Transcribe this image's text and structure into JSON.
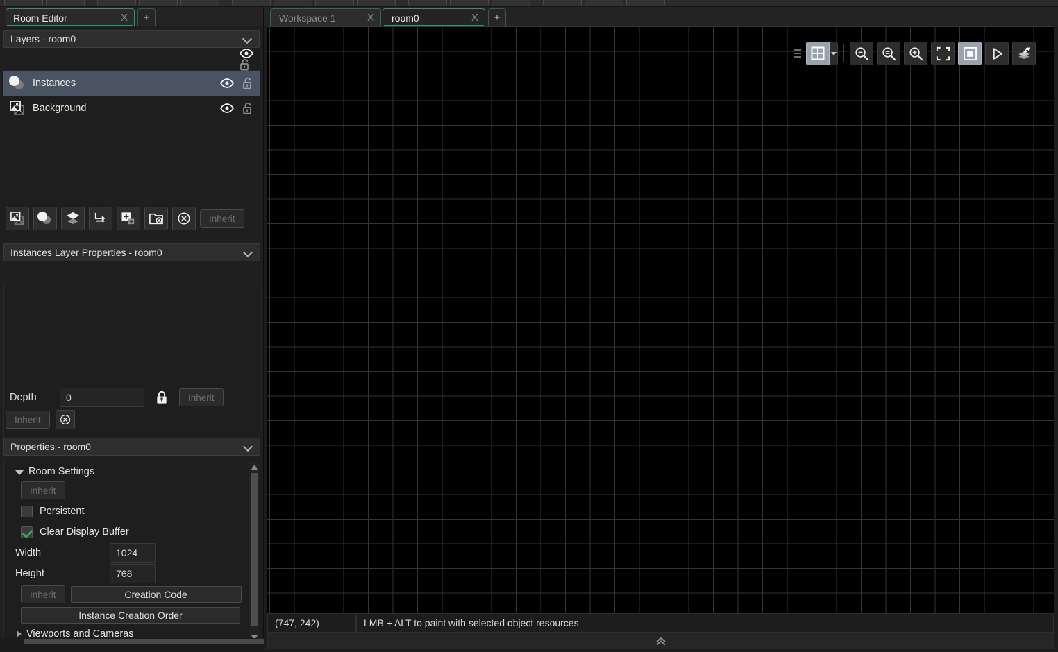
{
  "app": {
    "accent_green": "#16a864",
    "selection_blue": "#4a5361"
  },
  "left_dock": {
    "tab": {
      "title": "Room Editor",
      "close": "X",
      "add": "+"
    },
    "layers_panel": {
      "title": "Layers - room0",
      "chevron_icon": "chevron-down-icon",
      "layers": [
        {
          "name": "Instances",
          "type_icon": "instances-layer-icon",
          "visible_icon": "eye-icon",
          "lock_icon": "unlocked-padlock-icon",
          "selected": true
        },
        {
          "name": "Background",
          "type_icon": "background-layer-icon",
          "visible_icon": "eye-icon",
          "lock_icon": "unlocked-padlock-icon",
          "selected": false
        }
      ],
      "header_icons": {
        "visible_icon": "eye-icon",
        "lock_icon": "unlocked-padlock-icon"
      }
    },
    "layer_tools": [
      {
        "name": "add-background-layer-button",
        "icon": "image-layer-icon"
      },
      {
        "name": "add-instance-layer-button",
        "icon": "instances-layer-icon"
      },
      {
        "name": "add-asset-layer-button",
        "icon": "stacked-diamonds-icon"
      },
      {
        "name": "add-path-layer-button",
        "icon": "path-corner-arrow-icon"
      },
      {
        "name": "add-tile-layer-button",
        "icon": "plus-square-icon"
      },
      {
        "name": "add-layer-folder-button",
        "icon": "folder-plus-icon"
      },
      {
        "name": "delete-layer-button",
        "icon": "circle-x-icon"
      }
    ],
    "layer_tools_inherit": "Inherit",
    "layer_properties_panel": {
      "title": "Instances Layer Properties - room0",
      "chevron_icon": "chevron-down-icon",
      "depth_label": "Depth",
      "depth_value": "0",
      "depth_lock_icon": "locked-padlock-icon",
      "depth_inherit": "Inherit",
      "bottom_inherit": "Inherit",
      "bottom_clear_icon": "circle-x-icon"
    },
    "properties_panel": {
      "title": "Properties - room0",
      "chevron_icon": "chevron-down-icon",
      "room_settings": {
        "group_label": "Room Settings",
        "expanded": true,
        "inherit_label": "Inherit",
        "persistent": {
          "label": "Persistent",
          "checked": false
        },
        "clear_display_buffer": {
          "label": "Clear Display Buffer",
          "checked": true
        },
        "width": {
          "label": "Width",
          "value": "1024"
        },
        "height": {
          "label": "Height",
          "value": "768"
        },
        "creation_code_inherit": "Inherit",
        "creation_code_button": "Creation Code",
        "instance_creation_order_button": "Instance Creation Order"
      },
      "viewports_group": {
        "group_label": "Viewports and Cameras",
        "expanded": false
      }
    }
  },
  "main": {
    "tabs": [
      {
        "label": "Workspace 1",
        "close": "X",
        "active": false
      },
      {
        "label": "room0",
        "close": "X",
        "active": true
      }
    ],
    "add_tab": "+",
    "canvas_toolbar": [
      {
        "name": "grid-toggle-button",
        "icon": "grid-icon",
        "active": true,
        "has_dropdown": true
      },
      {
        "name": "zoom-out-button",
        "icon": "magnifier-minus-icon",
        "active": false
      },
      {
        "name": "zoom-reset-button",
        "icon": "magnifier-equals-icon",
        "active": false
      },
      {
        "name": "zoom-in-button",
        "icon": "magnifier-plus-icon",
        "active": false
      },
      {
        "name": "fit-to-screen-button",
        "icon": "fullscreen-brackets-icon",
        "active": false
      },
      {
        "name": "show-room-border-button",
        "icon": "nested-square-icon",
        "active": true
      },
      {
        "name": "run-room-button",
        "icon": "play-triangle-icon",
        "active": false
      },
      {
        "name": "layer-tools-button",
        "icon": "layers-arrow-icon",
        "active": false
      }
    ],
    "status": {
      "coordinates": "(747, 242)",
      "hint": "LMB + ALT to paint with selected object resources",
      "collapse_icon": "double-chevron-up-icon"
    }
  }
}
